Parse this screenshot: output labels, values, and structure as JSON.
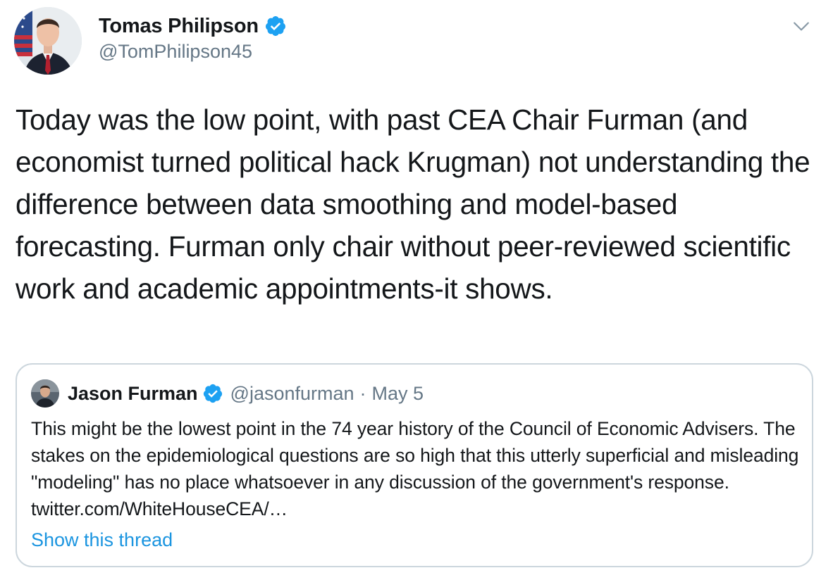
{
  "tweet": {
    "author": {
      "display_name": "Tomas Philipson",
      "handle": "@TomPhilipson45",
      "verified": true,
      "verified_icon": "verified-badge-icon"
    },
    "menu_icon": "chevron-down-icon",
    "text": "Today was the low point, with past CEA Chair Furman (and economist turned political hack Krugman) not understanding the difference between data smoothing and model-based forecasting. Furman only chair without peer-reviewed scientific work and academic appointments-it shows."
  },
  "quoted_tweet": {
    "author": {
      "display_name": "Jason Furman",
      "handle": "@jasonfurman",
      "verified": true
    },
    "separator": "·",
    "date": "May 5",
    "text_main": "This might be the lowest point in the 74 year history of the Council of Economic Advisers. The stakes on the epidemiological questions are so high that this utterly superficial and misleading \"modeling\" has no place whatsoever in any discussion of the government's response. ",
    "link_text": "twitter.com/WhiteHouseCEA/…",
    "show_thread_label": "Show this thread"
  },
  "colors": {
    "text": "#14171a",
    "secondary": "#657786",
    "verified_blue": "#1da1f2",
    "link_blue": "#1b95e0",
    "border": "#ccd6dd"
  }
}
